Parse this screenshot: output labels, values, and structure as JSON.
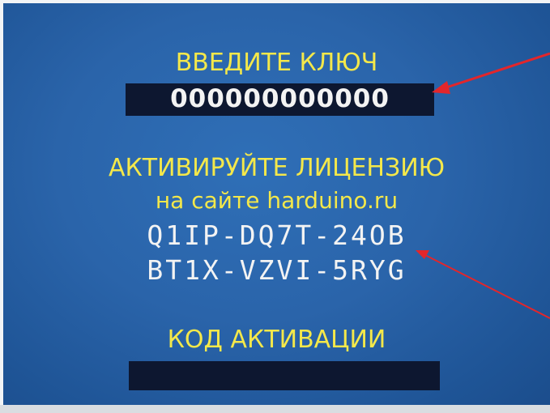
{
  "screen": {
    "enter_key_title": "ВВЕДИТЕ КЛЮЧ",
    "key_value": "000000000000",
    "activate_line": "АКТИВИРУЙТЕ ЛИЦЕНЗИЮ",
    "site_line": "на сайте harduino.ru",
    "license_code_1": "Q1IP-DQ7T-24OB",
    "license_code_2": "BT1X-VZVI-5RYG",
    "activation_code_title": "КОД АКТИВАЦИИ",
    "activation_code_value": ""
  },
  "colors": {
    "background": "#2a64aa",
    "label_yellow": "#f4e84a",
    "value_white": "#f3f3f3",
    "field_dark": "#0d1730",
    "annotation_arrow": "#e3262b"
  }
}
